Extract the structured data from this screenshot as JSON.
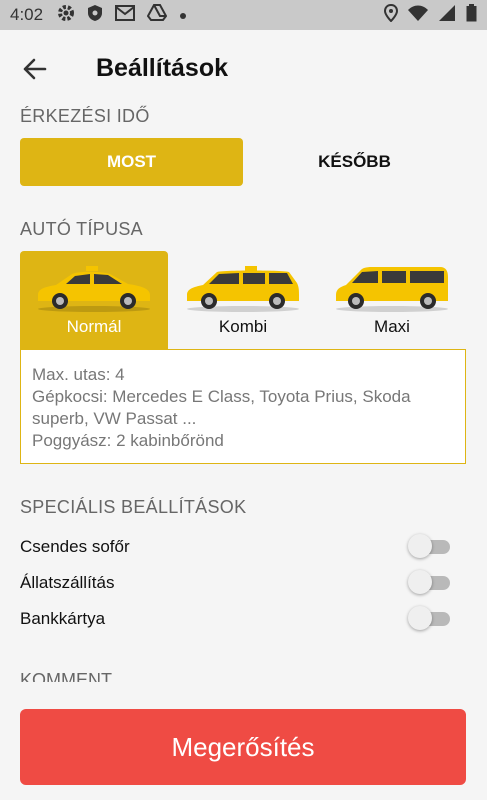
{
  "status_bar": {
    "time": "4:02",
    "icons": [
      "gear-icon",
      "shield-icon",
      "gmail-icon",
      "drive-icon",
      "dot-icon"
    ],
    "right_icons": [
      "location-icon",
      "wifi-icon",
      "signal-icon",
      "battery-icon"
    ]
  },
  "header": {
    "title": "Beállítások",
    "back_icon": "arrow-left-icon"
  },
  "arrival": {
    "label": "ÉRKEZÉSI IDŐ",
    "options": [
      "MOST",
      "KÉSŐBB"
    ],
    "selected": "MOST"
  },
  "car_type": {
    "label": "AUTÓ TÍPUSA",
    "options": [
      {
        "label": "Normál",
        "icon": "sedan-car-icon"
      },
      {
        "label": "Kombi",
        "icon": "wagon-car-icon"
      },
      {
        "label": "Maxi",
        "icon": "van-car-icon"
      }
    ],
    "selected": "Normál",
    "details": {
      "line1": "Max. utas: 4",
      "line2": "Gépkocsi: Mercedes E Class, Toyota Prius, Skoda superb, VW Passat ...",
      "line3": "Poggyász: 2 kabinbőrönd"
    }
  },
  "special": {
    "label": "SPECIÁLIS BEÁLLÍTÁSOK",
    "toggles": [
      {
        "label": "Csendes sofőr",
        "on": false
      },
      {
        "label": "Állatszállítás",
        "on": false
      },
      {
        "label": "Bankkártya",
        "on": false
      }
    ]
  },
  "comment": {
    "label": "KOMMENT"
  },
  "confirm_label": "Megerősítés",
  "colors": {
    "accent": "#deb514",
    "confirm": "#ef4b44",
    "background": "#f5f5f5"
  }
}
